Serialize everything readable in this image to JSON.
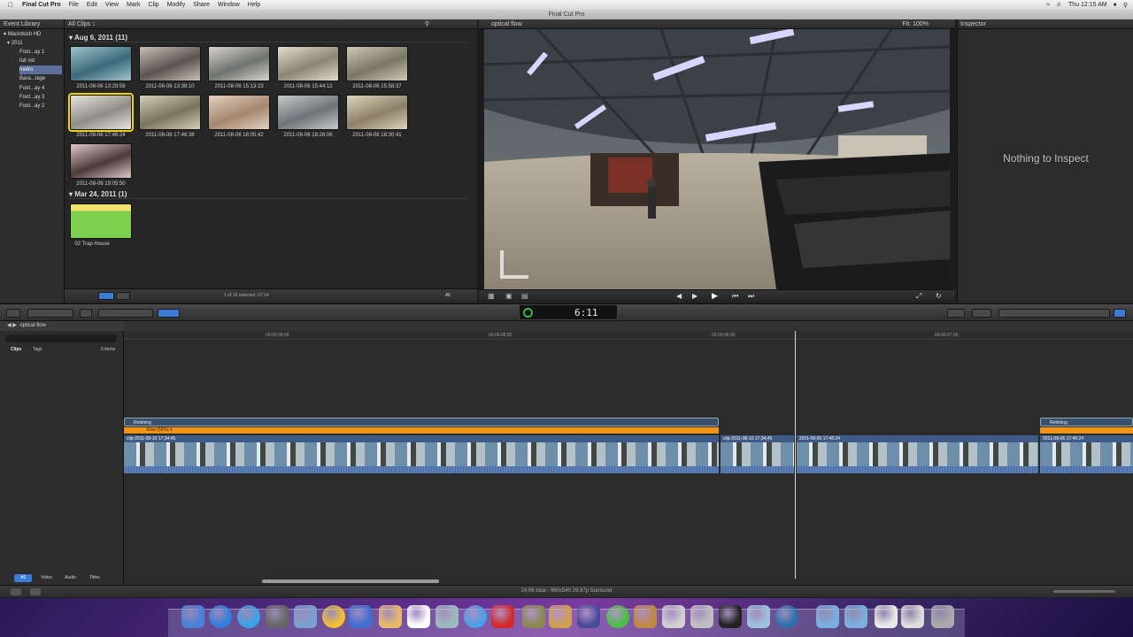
{
  "menubar": {
    "app": "Final Cut Pro",
    "items": [
      "File",
      "Edit",
      "View",
      "Mark",
      "Clip",
      "Modify",
      "Share",
      "Window",
      "Help"
    ],
    "clock": "Thu 12:15 AM"
  },
  "window_title": "Final Cut Pro",
  "event_library": {
    "title": "Event Library",
    "items": [
      {
        "label": "Macintosh HD"
      },
      {
        "label": "2011"
      },
      {
        "label": "Foot...ay 1"
      },
      {
        "label": "full vid"
      },
      {
        "label": "metro"
      },
      {
        "label": "Bara...tage"
      },
      {
        "label": "Foot...ay 4"
      },
      {
        "label": "Foot...ay 3"
      },
      {
        "label": "Foot...ay 2"
      }
    ]
  },
  "browser": {
    "filter": "All Clips ↕",
    "groups": [
      {
        "header": "Aug 6, 2011  (11)",
        "clips": [
          "2011-08-06 13:29:59",
          "2011-08-06 13:38:10",
          "2011-08-06 15:13:23",
          "2011-08-06 15:44:12",
          "2011-08-06 15:58:37",
          "2011-08-06 17:46:24",
          "2011-08-06 17:46:38",
          "2011-08-06 18:05:42",
          "2011-08-06 18:26:06",
          "2011-08-06 18:30:41",
          "2011-08-06 19:05:50"
        ]
      },
      {
        "header": "Mar 24, 2011  (1)",
        "clips": [
          "02 Trap House"
        ]
      }
    ],
    "footer_status": "1 of 15 selected, 07:14",
    "footer_all": "All"
  },
  "viewer": {
    "title": "optical flow",
    "fit_label": "Fit:",
    "fit_value": "100%"
  },
  "inspector": {
    "title": "Inspector",
    "empty_text": "Nothing to Inspect"
  },
  "timecode": "6:11",
  "timeline": {
    "project": "optical flow",
    "ruler": [
      "00:00:04;00",
      "00:00:05;00",
      "00:00:06;00",
      "00:00:07;00"
    ],
    "clips_tab": "Clips",
    "tags_tab": "Tags",
    "items_count": "0 items",
    "retiming_label": "Retiming",
    "slow_label": "Slow (50%) ▾",
    "clip1_label": "clip-2011-08-10 17;34;45",
    "clip2_label": "clip-2011-08-10 17;34;45",
    "clip3_label": "2011-08-06 17:46:24",
    "clip4_label": "2011-08-06 17:46:24",
    "index_tabs": [
      "All",
      "Video",
      "Audio",
      "Titles"
    ]
  },
  "statusbar": {
    "center": "24;06 total - 960x540 29.97p Surround"
  },
  "colors": {
    "accent": "#3d7bd9",
    "retiming_orange": "#f59312",
    "selection": "#5c6f9c"
  }
}
